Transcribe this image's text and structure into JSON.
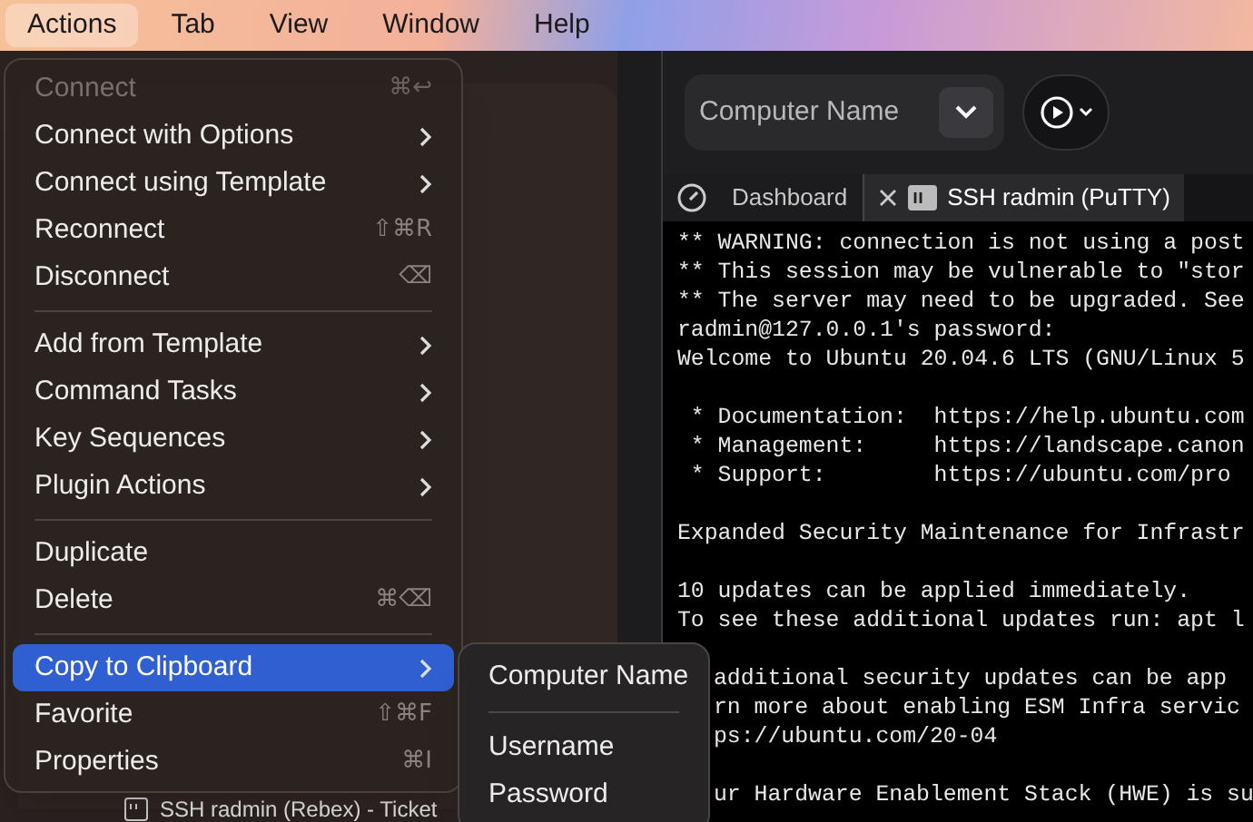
{
  "menu_bar": [
    {
      "label": "Actions",
      "selected": true
    },
    {
      "label": "Tab",
      "selected": false
    },
    {
      "label": "View",
      "selected": false
    },
    {
      "label": "Window",
      "selected": false
    },
    {
      "label": "Help",
      "selected": false
    }
  ],
  "toolbar": {
    "computer_field": {
      "placeholder": "Computer Name"
    }
  },
  "tabs": [
    {
      "label": "Dashboard",
      "kind": "dashboard",
      "selected": false
    },
    {
      "label": "SSH radmin (PuTTY)",
      "kind": "terminal",
      "selected": true
    }
  ],
  "terminal_lines": [
    {
      "kind": "full",
      "text": "** WARNING: connection is not using a post"
    },
    {
      "kind": "full",
      "text": "** This session may be vulnerable to \"stor"
    },
    {
      "kind": "full",
      "text": "** The server may need to be upgraded. See"
    },
    {
      "kind": "full",
      "text": "radmin@127.0.0.1's password:"
    },
    {
      "kind": "full",
      "text": "Welcome to Ubuntu 20.04.6 LTS (GNU/Linux 5"
    },
    {
      "kind": "blank"
    },
    {
      "kind": "full",
      "text": " * Documentation:  https://help.ubuntu.com"
    },
    {
      "kind": "full",
      "text": " * Management:     https://landscape.canon"
    },
    {
      "kind": "full",
      "text": " * Support:        https://ubuntu.com/pro"
    },
    {
      "kind": "blank"
    },
    {
      "kind": "full",
      "text": "Expanded Security Maintenance for Infrastr"
    },
    {
      "kind": "blank"
    },
    {
      "kind": "full",
      "text": "10 updates can be applied immediately."
    },
    {
      "kind": "full",
      "text": "To see these additional updates run: apt l"
    },
    {
      "kind": "blank"
    },
    {
      "kind": "partial",
      "text": "additional security updates can be app"
    },
    {
      "kind": "partial",
      "text": "rn more about enabling ESM Infra servic"
    },
    {
      "kind": "partial",
      "text": "ps://ubuntu.com/20-04"
    },
    {
      "kind": "blank"
    },
    {
      "kind": "partial",
      "text": "ur Hardware Enablement Stack (HWE) is su"
    }
  ],
  "sidebar_peek": {
    "label": "SSH radmin (Rebex) - Ticket"
  },
  "menu": [
    {
      "kind": "item",
      "label": "Connect",
      "shortcut": "⌘↩",
      "submenu": false,
      "disabled": true,
      "selected": false
    },
    {
      "kind": "item",
      "label": "Connect with Options",
      "submenu": true,
      "disabled": false,
      "selected": false
    },
    {
      "kind": "item",
      "label": "Connect using Template",
      "submenu": true,
      "disabled": false,
      "selected": false
    },
    {
      "kind": "item",
      "label": "Reconnect",
      "shortcut": "⇧⌘R",
      "submenu": false,
      "disabled": false,
      "selected": false
    },
    {
      "kind": "item",
      "label": "Disconnect",
      "shortcut": "⌫",
      "submenu": false,
      "disabled": false,
      "selected": false
    },
    {
      "kind": "separator"
    },
    {
      "kind": "item",
      "label": "Add from Template",
      "submenu": true,
      "disabled": false,
      "selected": false
    },
    {
      "kind": "item",
      "label": "Command Tasks",
      "submenu": true,
      "disabled": false,
      "selected": false
    },
    {
      "kind": "item",
      "label": "Key Sequences",
      "submenu": true,
      "disabled": false,
      "selected": false
    },
    {
      "kind": "item",
      "label": "Plugin Actions",
      "submenu": true,
      "disabled": false,
      "selected": false
    },
    {
      "kind": "separator"
    },
    {
      "kind": "item",
      "label": "Duplicate",
      "submenu": false,
      "disabled": false,
      "selected": false
    },
    {
      "kind": "item",
      "label": "Delete",
      "shortcut": "⌘⌫",
      "submenu": false,
      "disabled": false,
      "selected": false
    },
    {
      "kind": "separator"
    },
    {
      "kind": "item",
      "label": "Copy to Clipboard",
      "submenu": true,
      "disabled": false,
      "selected": true
    },
    {
      "kind": "item",
      "label": "Favorite",
      "shortcut": "⇧⌘F",
      "submenu": false,
      "disabled": false,
      "selected": false
    },
    {
      "kind": "item",
      "label": "Properties",
      "shortcut": "⌘I",
      "submenu": false,
      "disabled": false,
      "selected": false
    }
  ],
  "submenu": [
    {
      "kind": "item",
      "label": "Computer Name"
    },
    {
      "kind": "separator"
    },
    {
      "kind": "item",
      "label": "Username"
    },
    {
      "kind": "item",
      "label": "Password"
    }
  ]
}
